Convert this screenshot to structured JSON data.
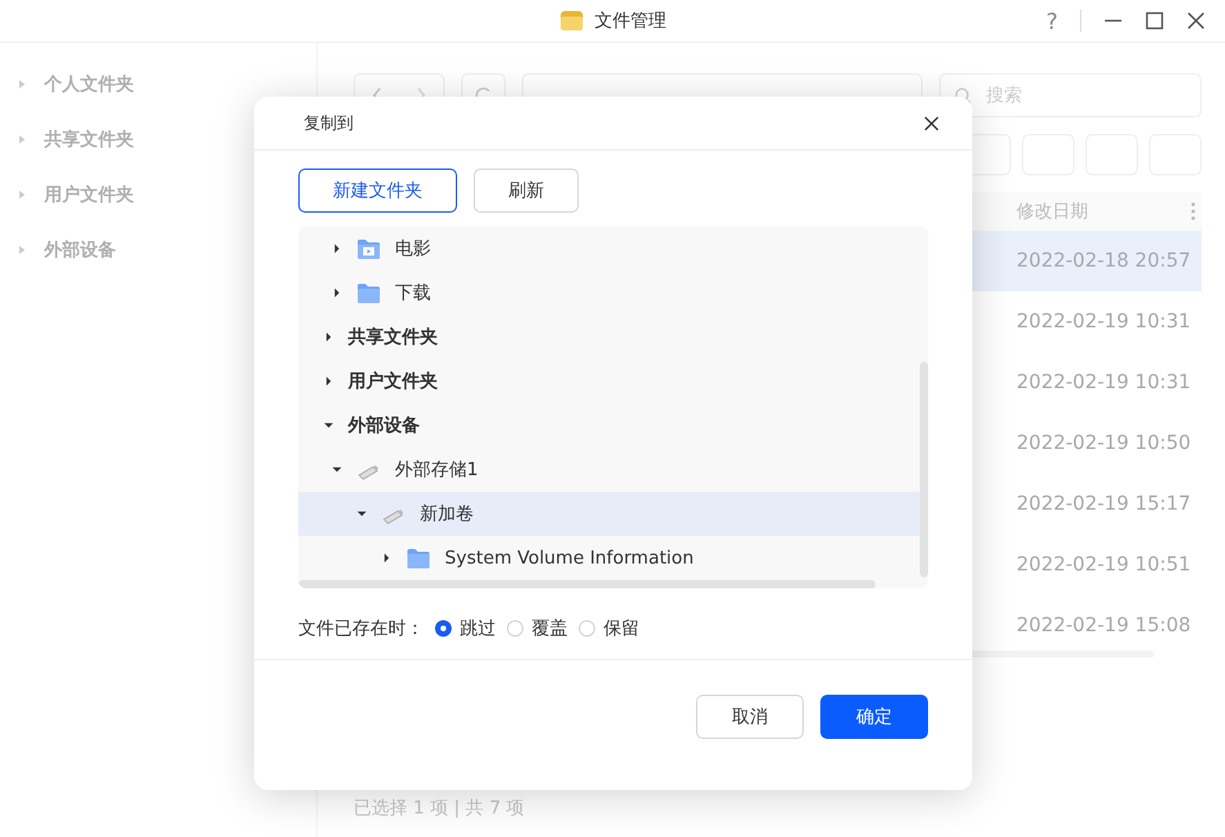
{
  "window": {
    "title": "文件管理",
    "help": "?"
  },
  "sidebar": {
    "items": [
      {
        "label": "个人文件夹"
      },
      {
        "label": "共享文件夹"
      },
      {
        "label": "用户文件夹"
      },
      {
        "label": "外部设备"
      }
    ]
  },
  "search": {
    "placeholder": "搜索"
  },
  "table": {
    "columns": [
      "修改日期"
    ],
    "rows": [
      {
        "date": "2022-02-18 20:57",
        "selected": true
      },
      {
        "date": "2022-02-19 10:31",
        "selected": false
      },
      {
        "date": "2022-02-19 10:31",
        "selected": false
      },
      {
        "date": "2022-02-19 10:50",
        "selected": false
      },
      {
        "date": "2022-02-19 15:17",
        "selected": false
      },
      {
        "date": "2022-02-19 10:51",
        "selected": false
      },
      {
        "date": "2022-02-19 15:08",
        "selected": false
      }
    ]
  },
  "status_bar": "已选择 1 项 | 共 7 项",
  "dialog": {
    "title": "复制到",
    "buttons_top": [
      "新建文件夹",
      "刷新"
    ],
    "tree": [
      {
        "children": [
          {
            "label": "电影",
            "kind": "video-folder",
            "expanded": false,
            "selected": false
          },
          {
            "label": "下载",
            "kind": "folder",
            "expanded": false,
            "selected": false
          }
        ]
      },
      {
        "label": "共享文件夹",
        "kind": "group",
        "expanded": false,
        "selected": false
      },
      {
        "label": "用户文件夹",
        "kind": "group",
        "expanded": false,
        "selected": false
      },
      {
        "label": "外部设备",
        "kind": "group",
        "expanded": true,
        "selected": false,
        "children": [
          {
            "label": "外部存储1",
            "kind": "drive",
            "expanded": true,
            "selected": false,
            "children": [
              {
                "label": "新加卷",
                "kind": "drive",
                "expanded": true,
                "selected": true,
                "children": [
                  {
                    "label": "System Volume Information",
                    "kind": "folder",
                    "expanded": false,
                    "selected": false
                  }
                ]
              }
            ]
          }
        ]
      }
    ],
    "conflict": {
      "label": "文件已存在时：",
      "options": [
        {
          "label": "跳过",
          "selected": true
        },
        {
          "label": "覆盖",
          "selected": false
        },
        {
          "label": "保留",
          "selected": false
        }
      ]
    },
    "cancel": "取消",
    "ok": "确定"
  }
}
